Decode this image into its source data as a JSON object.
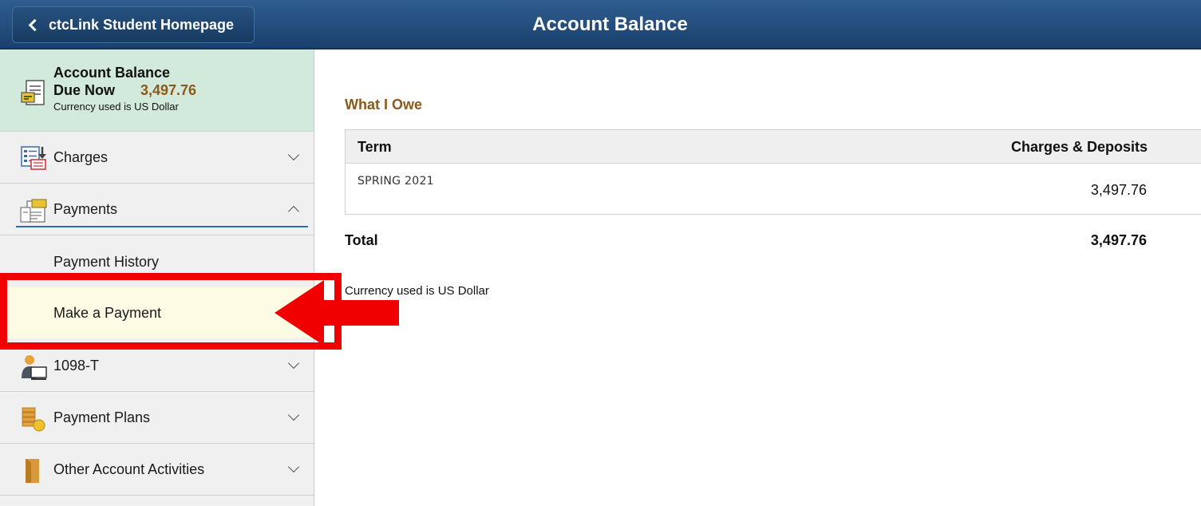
{
  "header": {
    "back_label": "ctcLink Student Homepage",
    "title": "Account Balance"
  },
  "summary": {
    "title": "Account Balance",
    "due_label": "Due Now",
    "due_amount": "3,497.76",
    "currency": "Currency used is US Dollar"
  },
  "nav": {
    "charges": "Charges",
    "payments": "Payments",
    "payment_history": "Payment History",
    "make_payment": "Make a Payment",
    "t1098": "1098-T",
    "payment_plans": "Payment Plans",
    "other_activities": "Other Account Activities"
  },
  "main": {
    "section_title": "What I Owe",
    "table": {
      "col_term": "Term",
      "col_charges": "Charges & Deposits",
      "rows": [
        {
          "term": "SPRING 2021",
          "amount": "3,497.76"
        }
      ]
    },
    "total_label": "Total",
    "total_amount": "3,497.76",
    "currency_note": "Currency used is US Dollar"
  },
  "colors": {
    "header": "#1b416d",
    "accent_text": "#8b5a1a",
    "summary_bg": "#d2eadb",
    "highlight": "#f00000",
    "active_bg": "#fdfbe4"
  }
}
